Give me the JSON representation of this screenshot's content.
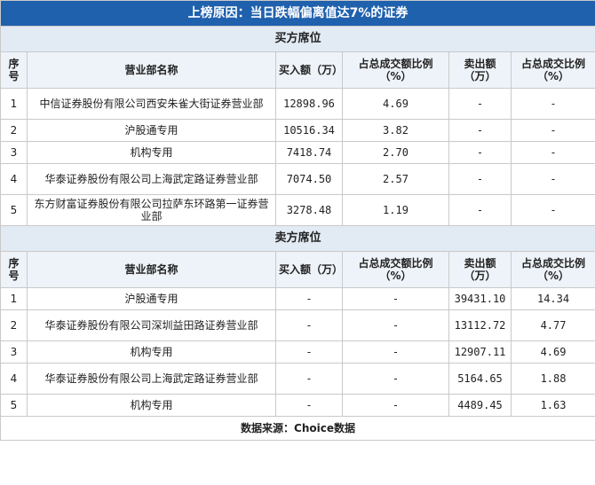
{
  "title": "上榜原因：当日跌幅偏离值达7%的证券",
  "headers": {
    "index": "序号",
    "name": "营业部名称",
    "buy": "买入额（万）",
    "buy_ratio": "占总成交额比例（%）",
    "sell": "卖出额（万）",
    "sell_ratio": "占总成交比例（%）"
  },
  "buy_section": {
    "title": "买方席位",
    "rows": [
      {
        "index": "1",
        "name": "中信证券股份有限公司西安朱雀大街证券营业部",
        "buy": "12898.96",
        "buy_ratio": "4.69",
        "sell": "-",
        "sell_ratio": "-"
      },
      {
        "index": "2",
        "name": "沪股通专用",
        "buy": "10516.34",
        "buy_ratio": "3.82",
        "sell": "-",
        "sell_ratio": "-"
      },
      {
        "index": "3",
        "name": "机构专用",
        "buy": "7418.74",
        "buy_ratio": "2.70",
        "sell": "-",
        "sell_ratio": "-"
      },
      {
        "index": "4",
        "name": "华泰证券股份有限公司上海武定路证券营业部",
        "buy": "7074.50",
        "buy_ratio": "2.57",
        "sell": "-",
        "sell_ratio": "-"
      },
      {
        "index": "5",
        "name": "东方财富证券股份有限公司拉萨东环路第一证券营业部",
        "buy": "3278.48",
        "buy_ratio": "1.19",
        "sell": "-",
        "sell_ratio": "-"
      }
    ]
  },
  "sell_section": {
    "title": "卖方席位",
    "rows": [
      {
        "index": "1",
        "name": "沪股通专用",
        "buy": "-",
        "buy_ratio": "-",
        "sell": "39431.10",
        "sell_ratio": "14.34"
      },
      {
        "index": "2",
        "name": "华泰证券股份有限公司深圳益田路证券营业部",
        "buy": "-",
        "buy_ratio": "-",
        "sell": "13112.72",
        "sell_ratio": "4.77"
      },
      {
        "index": "3",
        "name": "机构专用",
        "buy": "-",
        "buy_ratio": "-",
        "sell": "12907.11",
        "sell_ratio": "4.69"
      },
      {
        "index": "4",
        "name": "华泰证券股份有限公司上海武定路证券营业部",
        "buy": "-",
        "buy_ratio": "-",
        "sell": "5164.65",
        "sell_ratio": "1.88"
      },
      {
        "index": "5",
        "name": "机构专用",
        "buy": "-",
        "buy_ratio": "-",
        "sell": "4489.45",
        "sell_ratio": "1.63"
      }
    ]
  },
  "footer": "数据来源：Choice数据"
}
